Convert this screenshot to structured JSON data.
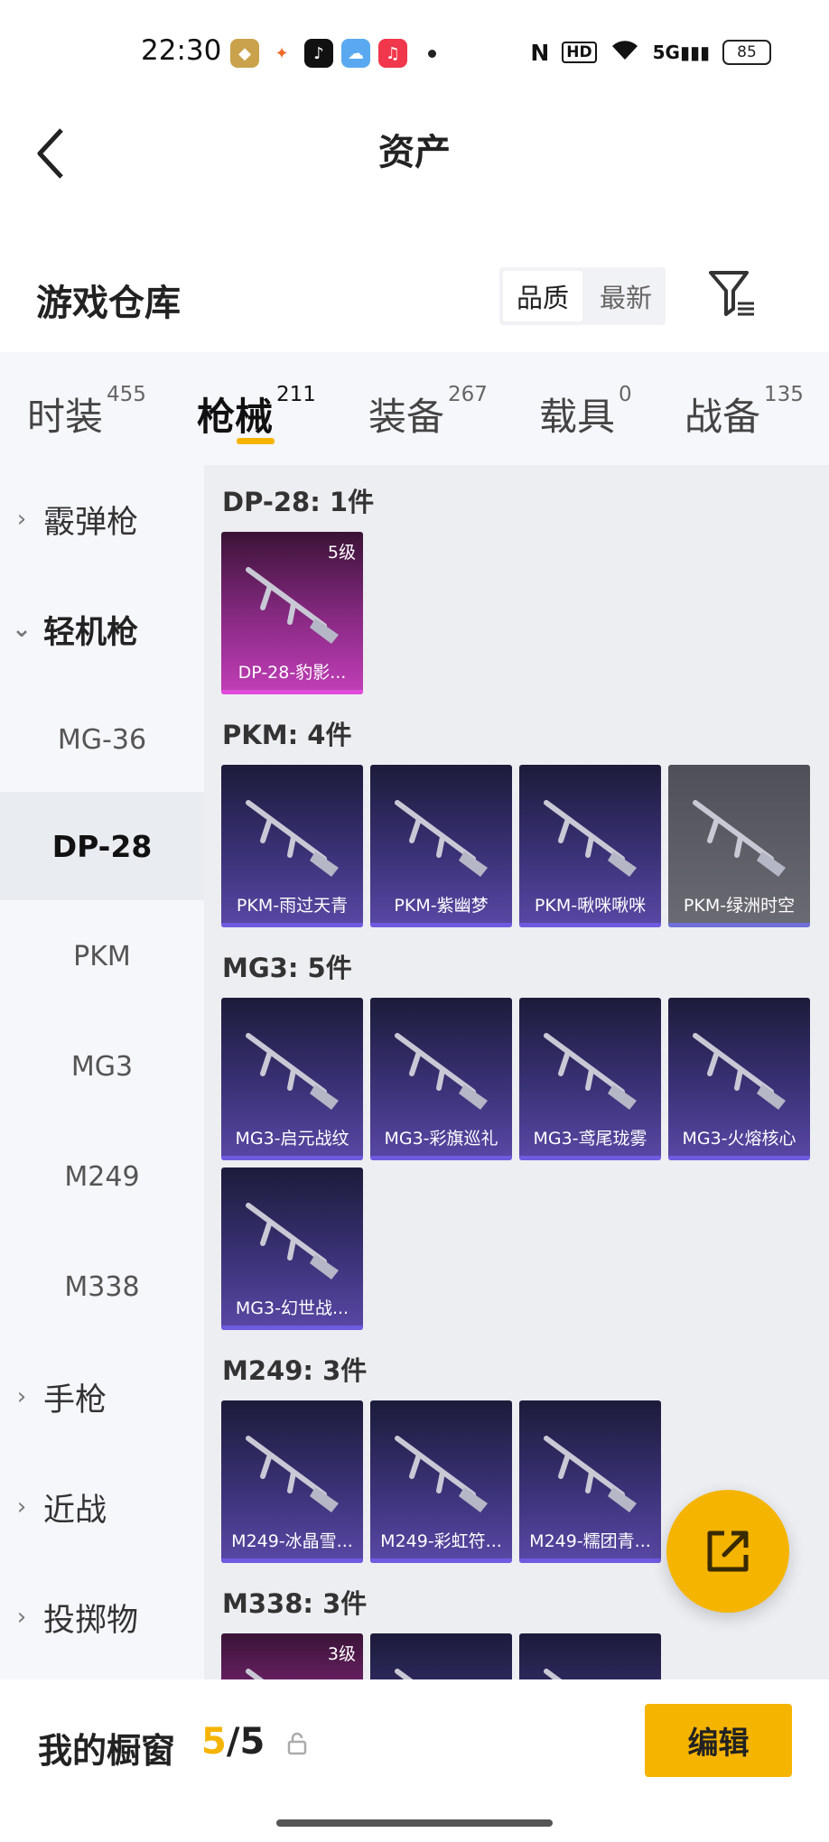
{
  "status_bar": {
    "time": "22:30",
    "battery": "85",
    "hd": "HD",
    "net": "5G"
  },
  "header": {
    "title": "资产"
  },
  "warehouse": {
    "title": "游戏仓库",
    "sort_options": [
      "品质",
      "最新"
    ],
    "active_sort": "品质"
  },
  "tabs": [
    {
      "label": "时装",
      "count": "455"
    },
    {
      "label": "枪械",
      "count": "211",
      "active": true
    },
    {
      "label": "装备",
      "count": "267"
    },
    {
      "label": "载具",
      "count": "0"
    },
    {
      "label": "战备",
      "count": "135"
    }
  ],
  "sidebar": {
    "categories": [
      {
        "label": "霰弹枪",
        "expanded": false
      },
      {
        "label": "轻机枪",
        "expanded": true
      },
      {
        "label": "手枪",
        "expanded": false
      },
      {
        "label": "近战",
        "expanded": false
      },
      {
        "label": "投掷物",
        "expanded": false
      }
    ],
    "subitems": [
      "MG-36",
      "DP-28",
      "PKM",
      "MG3",
      "M249",
      "M338"
    ],
    "active_sub": "DP-28"
  },
  "groups": [
    {
      "title": "DP-28: 1件",
      "items": [
        {
          "name": "DP-28-豹影...",
          "rarity": "purple",
          "level": "5级"
        }
      ]
    },
    {
      "title": "PKM: 4件",
      "items": [
        {
          "name": "PKM-雨过天青",
          "rarity": "blue"
        },
        {
          "name": "PKM-紫幽梦",
          "rarity": "blue"
        },
        {
          "name": "PKM-啾咪啾咪",
          "rarity": "blue"
        },
        {
          "name": "PKM-绿洲时空",
          "rarity": "grey"
        }
      ]
    },
    {
      "title": "MG3: 5件",
      "items": [
        {
          "name": "MG3-启元战纹",
          "rarity": "blue"
        },
        {
          "name": "MG3-彩旗巡礼",
          "rarity": "blue"
        },
        {
          "name": "MG3-鸢尾珑雾",
          "rarity": "blue"
        },
        {
          "name": "MG3-火熔核心",
          "rarity": "blue"
        },
        {
          "name": "MG3-幻世战...",
          "rarity": "blue"
        }
      ]
    },
    {
      "title": "M249: 3件",
      "items": [
        {
          "name": "M249-冰晶雪...",
          "rarity": "blue"
        },
        {
          "name": "M249-彩虹符...",
          "rarity": "blue"
        },
        {
          "name": "M249-糯团青...",
          "rarity": "blue"
        }
      ]
    },
    {
      "title": "M338: 3件",
      "items": [
        {
          "name": "",
          "rarity": "purple",
          "level": "3级"
        },
        {
          "name": "",
          "rarity": "blue"
        },
        {
          "name": "",
          "rarity": "blue"
        }
      ]
    }
  ],
  "bottom": {
    "label": "我的橱窗",
    "count_current": "5",
    "count_sep": "/",
    "count_total": "5",
    "edit_label": "编辑"
  },
  "colors": {
    "accent": "#f5b400",
    "card_blue": "#3a3277",
    "card_purple": "#8b2a86"
  }
}
